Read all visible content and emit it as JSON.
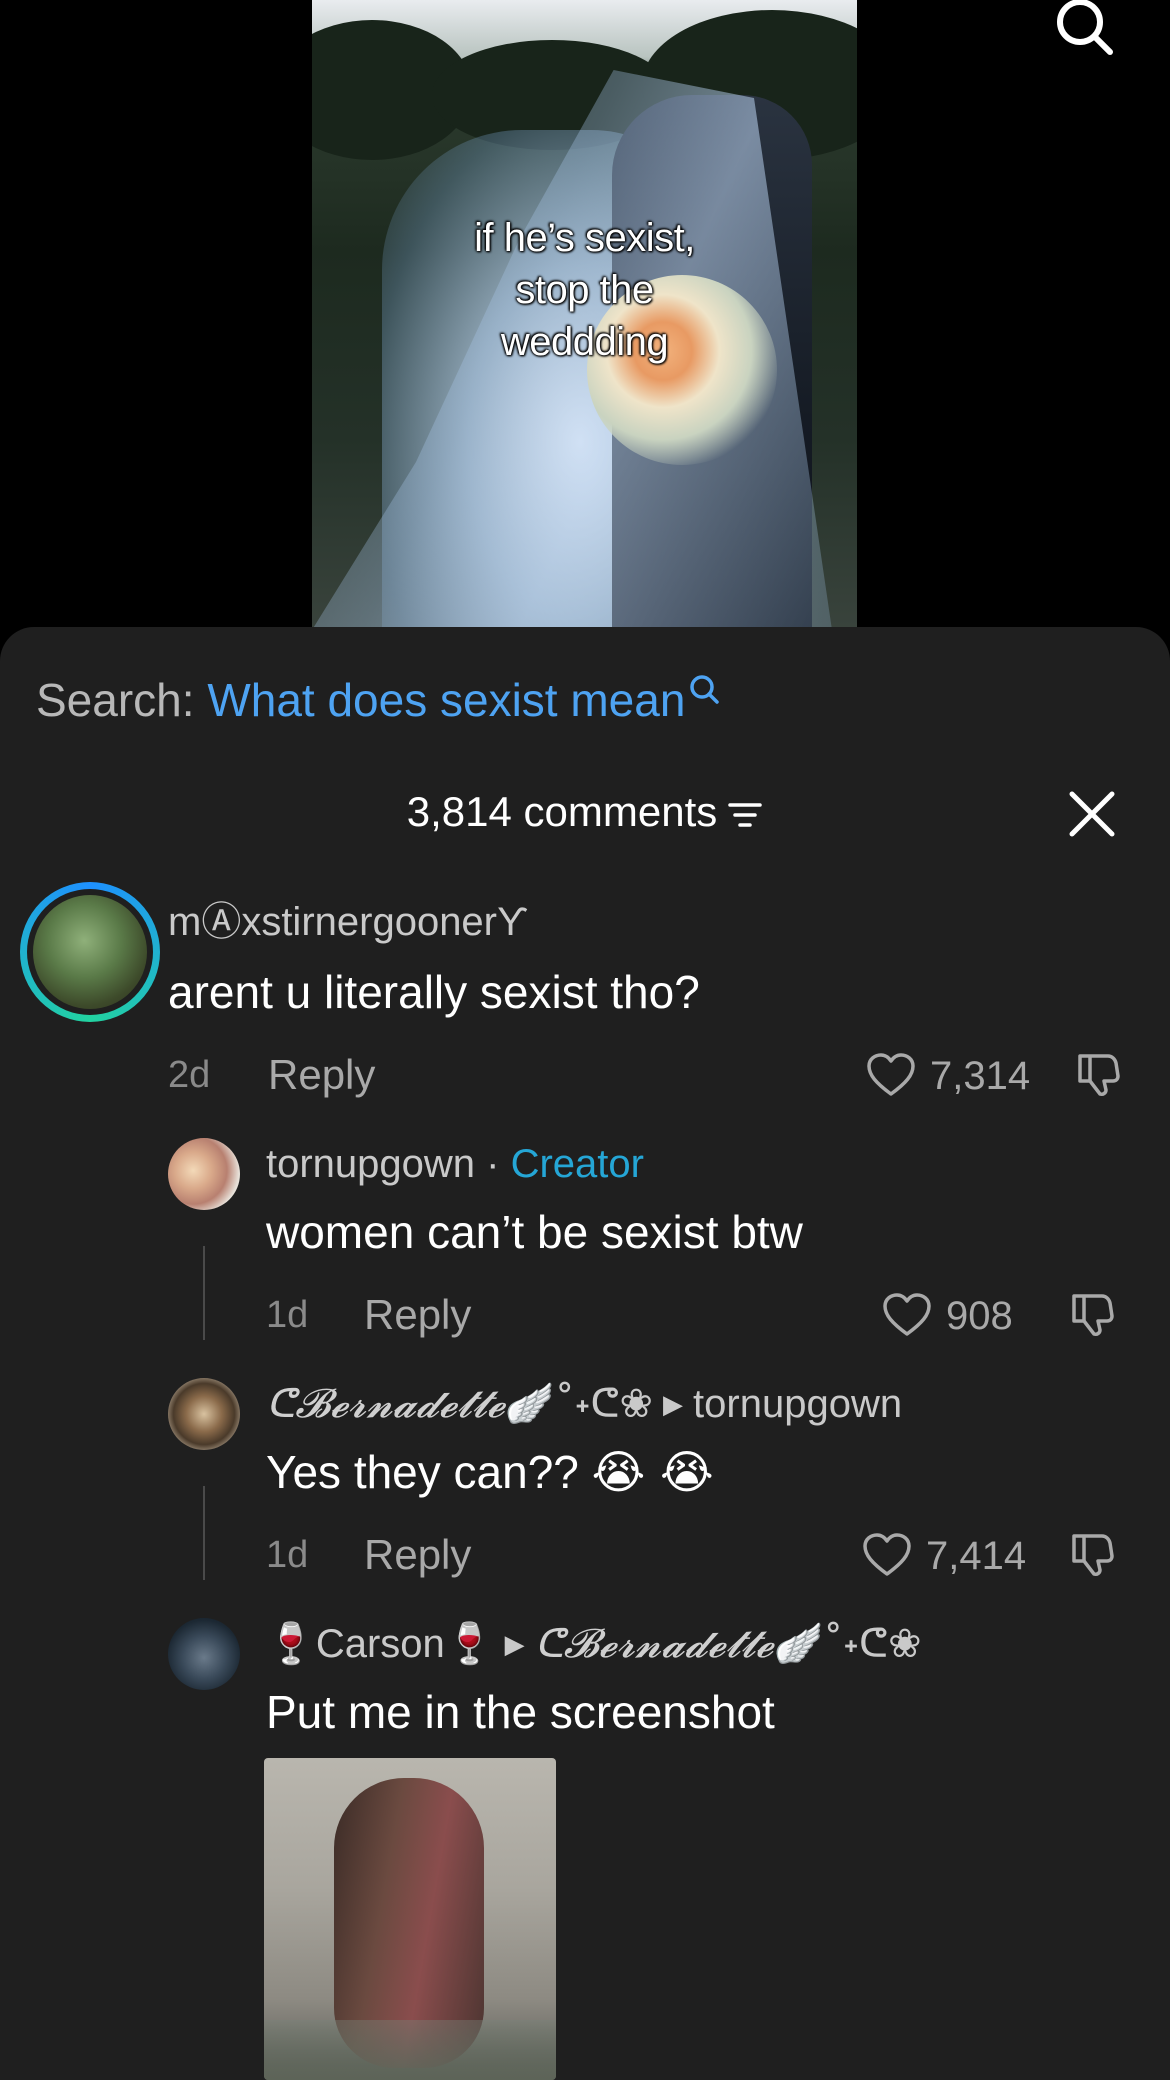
{
  "video": {
    "caption_lines": [
      "if he’s sexist,",
      "stop the",
      "weddding"
    ]
  },
  "search": {
    "label": "Search:",
    "query": "What does sexist mean"
  },
  "comments_header": {
    "count_label": "3,814 comments"
  },
  "comments": [
    {
      "username": "mⒶxstirnergooner",
      "username_suffix": "ϒ",
      "text": "arent u literally sexist tho?",
      "age": "2d",
      "reply_label": "Reply",
      "likes": "7,314"
    },
    {
      "username": "tornupgown",
      "separator": " · ",
      "badge": "Creator",
      "text": "women can’t be sexist btw",
      "age": "1d",
      "reply_label": "Reply",
      "likes": "908"
    },
    {
      "username": "ᕦ𝓑𝓮𝓻𝓷𝓪𝓭𝓮𝓽𝓽𝓮",
      "username_deco": "🪽˚˖ᕦ❀",
      "reply_to": "tornupgown",
      "text": "Yes they can??",
      "emojis": "😭 😭",
      "age": "1d",
      "reply_label": "Reply",
      "likes": "7,414"
    },
    {
      "username_prefix": "🍷",
      "username": "Carson",
      "username_suffix": "🍷",
      "reply_to": "ᕦ𝓑𝓮𝓻𝓷𝓪𝓭𝓮𝓽𝓽𝓮",
      "reply_to_deco": "🪽˚˖ᕦ❀",
      "text": "Put me in the screenshot"
    }
  ],
  "colors": {
    "sheet_bg": "#1f1f1f",
    "search_query": "#4ea3f2",
    "creator_badge": "#25a6d6",
    "avatar_ring_start": "#1e90ff",
    "avatar_ring_end": "#22d3a0"
  }
}
